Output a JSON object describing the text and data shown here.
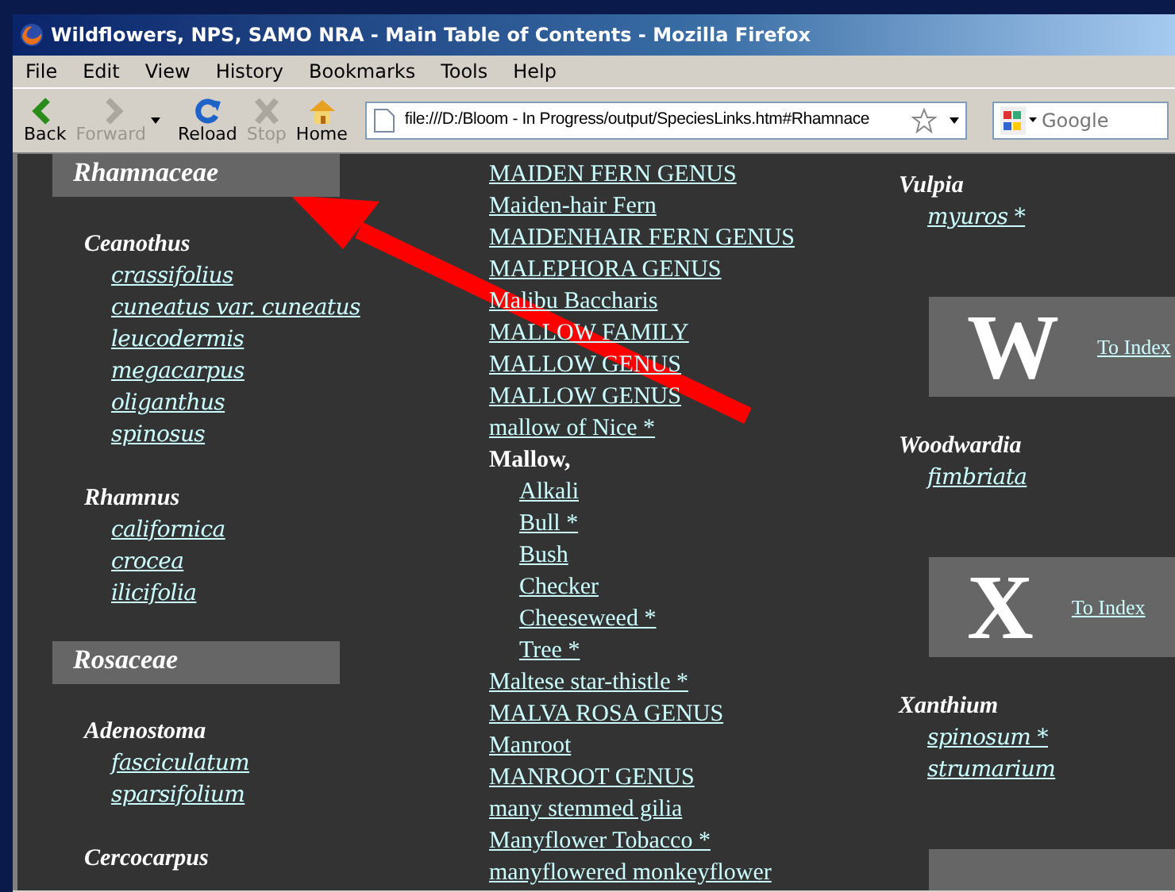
{
  "window": {
    "title": "Wildflowers, NPS, SAMO NRA - Main Table of Contents - Mozilla Firefox"
  },
  "menu": [
    "File",
    "Edit",
    "View",
    "History",
    "Bookmarks",
    "Tools",
    "Help"
  ],
  "toolbar": [
    {
      "kind": "back",
      "label": "Back",
      "disabled": false
    },
    {
      "kind": "forward",
      "label": "Forward",
      "disabled": true
    },
    {
      "kind": "reload",
      "label": "Reload",
      "disabled": false
    },
    {
      "kind": "stop",
      "label": "Stop",
      "disabled": true
    },
    {
      "kind": "home",
      "label": "Home",
      "disabled": false
    }
  ],
  "address": {
    "value": "file:///D:/Bloom - In Progress/output/SpeciesLinks.htm#Rhamnace"
  },
  "search": {
    "placeholder": "Google"
  },
  "columns": [
    [
      {
        "kind": "family",
        "label": "Rhamnaceae"
      },
      {
        "kind": "genus",
        "label": "Ceanothus",
        "species": [
          "crassifolius",
          "cuneatus var. cuneatus",
          "leucodermis",
          "megacarpus",
          "oliganthus",
          "spinosus"
        ]
      },
      {
        "kind": "genus",
        "label": "Rhamnus",
        "species": [
          "californica",
          "crocea",
          "ilicifolia"
        ]
      },
      {
        "kind": "family",
        "label": "Rosaceae"
      },
      {
        "kind": "genus",
        "label": "Adenostoma",
        "species": [
          "fasciculatum",
          "sparsifolium"
        ]
      },
      {
        "kind": "genus",
        "label": "Cercocarpus"
      }
    ],
    [
      {
        "kind": "link",
        "label": "MAIDEN FERN GENUS"
      },
      {
        "kind": "link",
        "label": "Maiden-hair Fern"
      },
      {
        "kind": "link",
        "label": "MAIDENHAIR FERN GENUS"
      },
      {
        "kind": "link",
        "label": "MALEPHORA GENUS"
      },
      {
        "kind": "link",
        "label": "Malibu Baccharis"
      },
      {
        "kind": "link",
        "label": "MALLOW FAMILY"
      },
      {
        "kind": "link",
        "label": "MALLOW GENUS"
      },
      {
        "kind": "link",
        "label": "MALLOW GENUS"
      },
      {
        "kind": "link",
        "label": "mallow of Nice *"
      },
      {
        "kind": "group",
        "label": "Mallow,",
        "children": [
          "Alkali",
          "Bull *",
          "Bush",
          "Checker",
          "Cheeseweed *",
          "Tree *"
        ]
      },
      {
        "kind": "link",
        "label": "Maltese star-thistle *"
      },
      {
        "kind": "link",
        "label": "MALVA ROSA GENUS"
      },
      {
        "kind": "link",
        "label": "Manroot"
      },
      {
        "kind": "link",
        "label": "MANROOT GENUS"
      },
      {
        "kind": "link",
        "label": "many stemmed gilia"
      },
      {
        "kind": "link",
        "label": "Manyflower Tobacco *"
      },
      {
        "kind": "link",
        "label": "manyflowered monkeyflower"
      }
    ],
    [
      {
        "kind": "genus",
        "label": "Vulpia",
        "species": [
          "myuros *"
        ]
      },
      {
        "kind": "letter",
        "letter": "W",
        "link": "To Index"
      },
      {
        "kind": "genus",
        "label": "Woodwardia",
        "species": [
          "fimbriata"
        ]
      },
      {
        "kind": "letter",
        "letter": "X",
        "link": "To Index"
      },
      {
        "kind": "genus",
        "label": "Xanthium",
        "species": [
          "spinosum *",
          "strumarium"
        ]
      },
      {
        "kind": "letter"
      }
    ]
  ]
}
